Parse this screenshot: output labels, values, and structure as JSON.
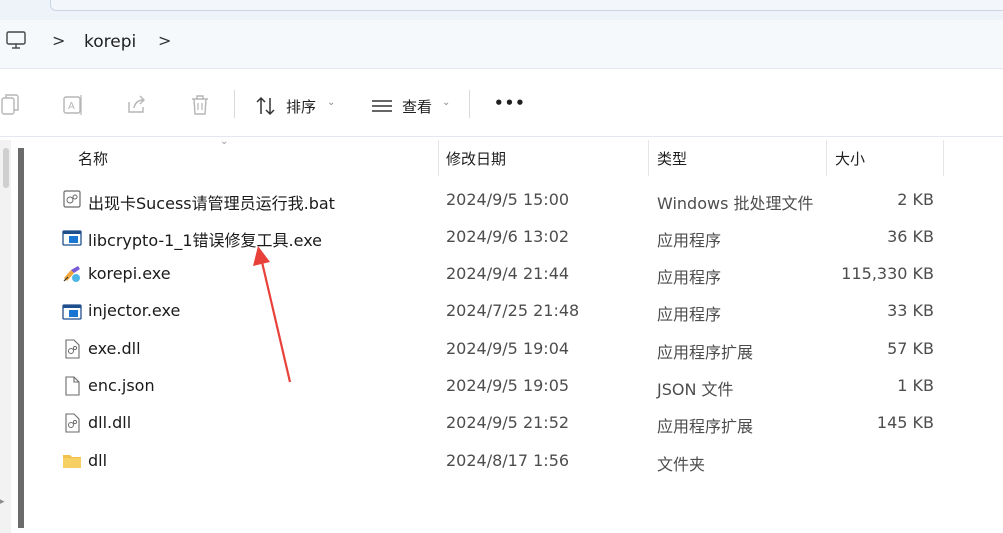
{
  "breadcrumb": {
    "folder": "korepi",
    "separator": ">"
  },
  "toolbar": {
    "sort_label": "排序",
    "view_label": "查看",
    "more_label": "•••"
  },
  "columns": {
    "name": "名称",
    "modified": "修改日期",
    "type": "类型",
    "size": "大小"
  },
  "files": [
    {
      "name": "出现卡Sucess请管理员运行我.bat",
      "modified": "2024/9/5 15:00",
      "type": "Windows 批处理文件",
      "size": "2 KB",
      "icon": "batch-file-icon"
    },
    {
      "name": "libcrypto-1_1错误修复工具.exe",
      "modified": "2024/9/6 13:02",
      "type": "应用程序",
      "size": "36 KB",
      "icon": "application-window-icon"
    },
    {
      "name": "korepi.exe",
      "modified": "2024/9/4 21:44",
      "type": "应用程序",
      "size": "115,330 KB",
      "icon": "korepi-app-icon"
    },
    {
      "name": "injector.exe",
      "modified": "2024/7/25 21:48",
      "type": "应用程序",
      "size": "33 KB",
      "icon": "application-window-icon"
    },
    {
      "name": "exe.dll",
      "modified": "2024/9/5 19:04",
      "type": "应用程序扩展",
      "size": "57 KB",
      "icon": "dll-gear-icon"
    },
    {
      "name": "enc.json",
      "modified": "2024/9/5 19:05",
      "type": "JSON 文件",
      "size": "1 KB",
      "icon": "blank-file-icon"
    },
    {
      "name": "dll.dll",
      "modified": "2024/9/5 21:52",
      "type": "应用程序扩展",
      "size": "145 KB",
      "icon": "dll-gear-icon"
    },
    {
      "name": "dll",
      "modified": "2024/8/17 1:56",
      "type": "文件夹",
      "size": "",
      "icon": "folder-icon"
    }
  ],
  "colors": {
    "annotation_arrow": "#e8413a",
    "folder": "#f2c14b",
    "app_icon_blue": "#1976d2"
  }
}
